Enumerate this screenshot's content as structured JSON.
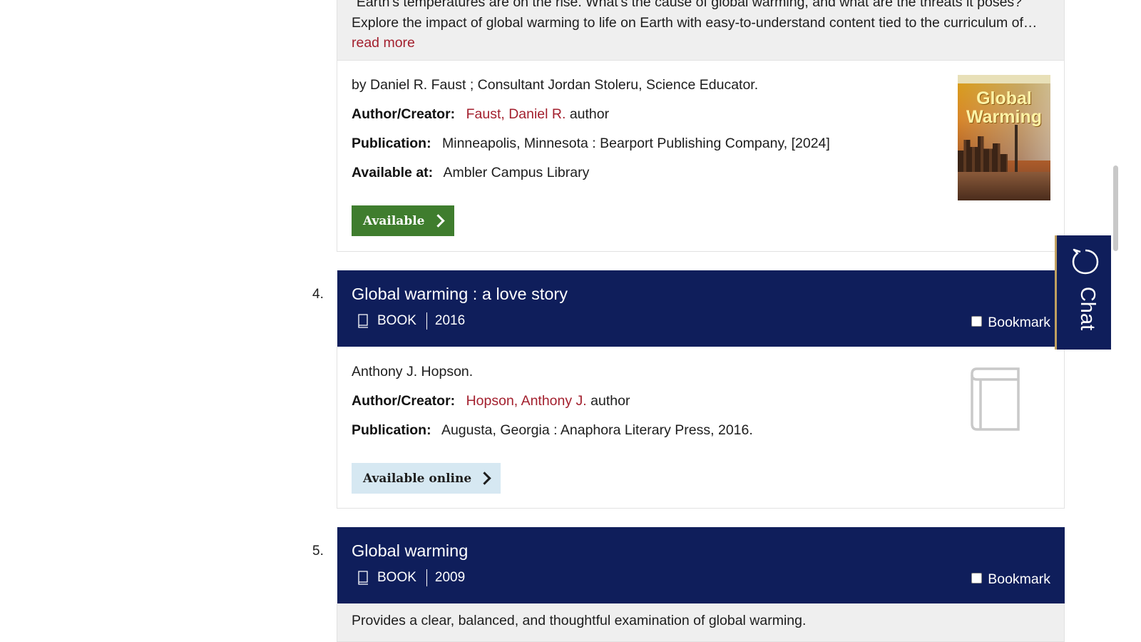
{
  "item3": {
    "summary_line1": "\"Earth's temperatures are on the rise. What's the cause of global warming, and what are the threats it poses?",
    "summary_line2": "Explore the impact of global warming to life on Earth with easy-to-understand content tied to the curriculum of…",
    "read_more": "read more",
    "statement": "by Daniel R. Faust ; Consultant Jordan Stoleru, Science Educator.",
    "author_label": "Author/Creator:",
    "author_link": "Faust, Daniel R.",
    "author_role": "author",
    "publication_label": "Publication:",
    "publication": "Minneapolis, Minnesota : Bearport Publishing Company, [2024]",
    "available_at_label": "Available at:",
    "available_at": "Ambler Campus Library",
    "button": "Available",
    "cover_title": "Global Warming"
  },
  "item4": {
    "number": "4.",
    "title": "Global warming : a love story",
    "format": "BOOK",
    "year": "2016",
    "bookmark": "Bookmark",
    "statement": "Anthony J. Hopson.",
    "author_label": "Author/Creator:",
    "author_link": "Hopson, Anthony J.",
    "author_role": "author",
    "publication_label": "Publication:",
    "publication": "Augusta, Georgia : Anaphora Literary Press, 2016.",
    "button": "Available online"
  },
  "item5": {
    "number": "5.",
    "title": "Global warming",
    "format": "BOOK",
    "year": "2009",
    "bookmark": "Bookmark",
    "summary": "Provides a clear, balanced, and thoughtful examination of global warming."
  },
  "chat": {
    "label": "Chat"
  },
  "colors": {
    "header_bg": "#0f1e5b",
    "available_green": "#3f7d2e",
    "link_red": "#a3202e",
    "online_bg": "#d6e8f2"
  }
}
